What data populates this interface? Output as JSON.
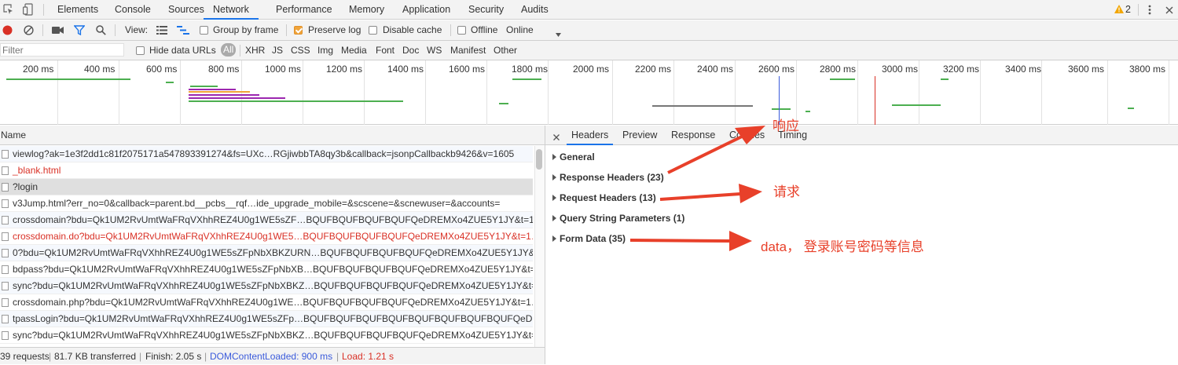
{
  "tabs": {
    "items": [
      "Elements",
      "Console",
      "Sources",
      "Network",
      "Performance",
      "Memory",
      "Application",
      "Security",
      "Audits"
    ],
    "warn_count": "2"
  },
  "toolbar": {
    "view_label": "View:",
    "group_by_frame": "Group by frame",
    "preserve_log": "Preserve log",
    "disable_cache": "Disable cache",
    "offline": "Offline",
    "throttle": "Online"
  },
  "filterbar": {
    "placeholder": "Filter",
    "hide_data_urls": "Hide data URLs",
    "types": [
      "All",
      "XHR",
      "JS",
      "CSS",
      "Img",
      "Media",
      "Font",
      "Doc",
      "WS",
      "Manifest",
      "Other"
    ]
  },
  "timeline": {
    "ticks": [
      "200 ms",
      "400 ms",
      "600 ms",
      "800 ms",
      "1000 ms",
      "1200 ms",
      "1400 ms",
      "1600 ms",
      "1800 ms",
      "2000 ms",
      "2200 ms",
      "2400 ms",
      "2600 ms",
      "2800 ms",
      "3000 ms",
      "3200 ms",
      "3400 ms",
      "3600 ms",
      "3800 ms"
    ]
  },
  "requests": {
    "header": "Name",
    "rows": [
      {
        "name": "viewlog?ak=1e3f2dd1c81f2075171a547893391274&fs=UXc…RGjiwbbTA8qy3b&callback=jsonpCallbackb9426&v=1605",
        "error": false
      },
      {
        "name": "_blank.html",
        "error": true
      },
      {
        "name": "?login",
        "error": false
      },
      {
        "name": "v3Jump.html?err_no=0&callback=parent.bd__pcbs__rqf…ide_upgrade_mobile=&scscene=&scnewuser=&accounts=",
        "error": false
      },
      {
        "name": "crossdomain?bdu=Qk1UM2RvUmtWaFRqVXhhREZ4U0g1WE5sZF…BQUFBQUFBQUFBQUFQeDREMXo4ZUE5Y1JY&t=1…",
        "error": false
      },
      {
        "name": "crossdomain.do?bdu=Qk1UM2RvUmtWaFRqVXhhREZ4U0g1WE5…BQUFBQUFBQUFBQUFQeDREMXo4ZUE5Y1JY&t=1…",
        "error": true
      },
      {
        "name": "0?bdu=Qk1UM2RvUmtWaFRqVXhhREZ4U0g1WE5sZFpNbXBKZURN…BQUFBQUFBQUFBQUFQeDREMXo4ZUE5Y1JY&t",
        "error": false
      },
      {
        "name": "bdpass?bdu=Qk1UM2RvUmtWaFRqVXhhREZ4U0g1WE5sZFpNbXB…BQUFBQUFBQUFBQUFQeDREMXo4ZUE5Y1JY&t=",
        "error": false
      },
      {
        "name": "sync?bdu=Qk1UM2RvUmtWaFRqVXhhREZ4U0g1WE5sZFpNbXBKZ…BQUFBQUFBQUFBQUFQeDREMXo4ZUE5Y1JY&t=",
        "error": false
      },
      {
        "name": "crossdomain.php?bdu=Qk1UM2RvUmtWaFRqVXhhREZ4U0g1WE…BQUFBQUFBQUFBQUFQeDREMXo4ZUE5Y1JY&t=1…",
        "error": false
      },
      {
        "name": "tpassLogin?bdu=Qk1UM2RvUmtWaFRqVXhhREZ4U0g1WE5sZFp…BQUFBQUFBQUFBQUFBQUFBQUFBQUFBQUFQeD…",
        "error": false
      },
      {
        "name": "sync?bdu=Qk1UM2RvUmtWaFRqVXhhREZ4U0g1WE5sZFpNbXBKZ…BQUFBQUFBQUFBQUFQeDREMXo4ZUE5Y1JY&t=",
        "error": false
      }
    ]
  },
  "status": {
    "requests": "39 requests",
    "transferred": "81.7 KB transferred",
    "finish": "Finish: 2.05 s",
    "dom": "DOMContentLoaded: 900 ms",
    "load": "Load: 1.21 s"
  },
  "detail": {
    "tabs": [
      "Headers",
      "Preview",
      "Response",
      "Cookies",
      "Timing"
    ],
    "sections": [
      "General",
      "Response Headers (23)",
      "Request Headers (13)",
      "Query String Parameters (1)",
      "Form Data (35)"
    ]
  },
  "annotations": {
    "response": "响应",
    "request": "请求",
    "data": "data，  登录账号密码等信息"
  },
  "colors": {
    "accent": "#1a73e8",
    "error": "#d93025",
    "annotation": "#e8402a",
    "record": "#d93025"
  }
}
